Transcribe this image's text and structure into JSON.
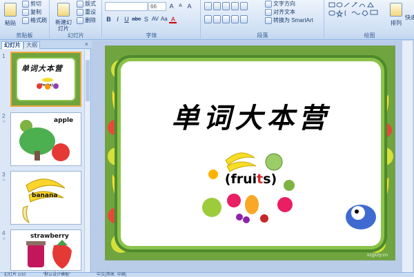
{
  "ribbon": {
    "clipboard": {
      "label": "剪贴板",
      "paste": "粘贴",
      "cut": "剪切",
      "copy": "复制",
      "format_painter": "格式刷"
    },
    "slides": {
      "label": "幻灯片",
      "new_slide": "新建幻灯片",
      "layout": "版式",
      "reset": "重设",
      "delete": "删除"
    },
    "font": {
      "label": "字体",
      "font_size": "66",
      "bold": "B",
      "italic": "I",
      "underline": "U",
      "strike": "abe",
      "shadow": "S",
      "spacing": "AV",
      "case": "Aa",
      "color": "A",
      "grow": "A",
      "shrink": "A",
      "clear": "A"
    },
    "paragraph": {
      "label": "段落",
      "text_direction": "文字方向",
      "align_text": "对齐文本",
      "smartart": "转换为 SmartArt"
    },
    "drawing": {
      "label": "绘图",
      "arrange": "排列",
      "quick_styles": "快速"
    }
  },
  "left_pane": {
    "tab_slides": "幻灯片",
    "tab_outline": "大纲",
    "close": "×",
    "thumbnails": [
      {
        "num": "1",
        "title": "单词大本营",
        "label": "(fruits)"
      },
      {
        "num": "2",
        "label": "apple"
      },
      {
        "num": "3",
        "label": "banana"
      },
      {
        "num": "4",
        "label": "strawberry"
      }
    ]
  },
  "slide": {
    "title": "单词大本营",
    "subtitle_open": "(frui",
    "subtitle_red": "t",
    "subtitle_close": "s)",
    "watermark": "xzgxzy.cn"
  },
  "status": {
    "slide_count": "幻灯片 1/10",
    "theme": "\"默认设计模板\"",
    "language": "中文(简体, 中国)"
  },
  "colors": {
    "ribbon_bg": "#d6e4f6",
    "slide_border_green": "#6fa43f",
    "accent_red": "#d8282a",
    "selection_orange": "#f0a53a"
  }
}
